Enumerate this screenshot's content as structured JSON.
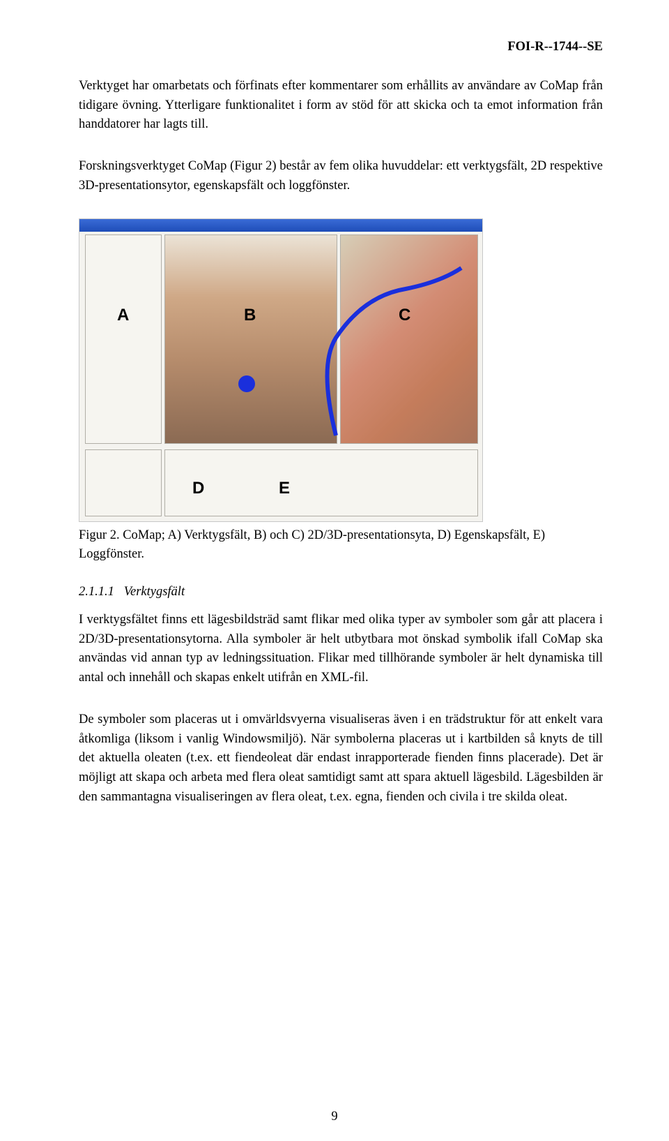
{
  "header": {
    "doc_number": "FOI-R--1744--SE"
  },
  "paragraphs": {
    "p1": "Verktyget har omarbetats och förfinats efter kommentarer som erhållits av användare av CoMap från tidigare övning. Ytterligare funktionalitet i form av stöd för att skicka och ta emot information från handdatorer har lagts till.",
    "p2": "Forskningsverktyget CoMap (Figur 2) består av fem olika huvuddelar: ett verktygsfält, 2D respektive 3D-presentationsytor, egenskapsfält och loggfönster."
  },
  "figure": {
    "labels": {
      "A": "A",
      "B": "B",
      "C": "C",
      "D": "D",
      "E": "E"
    },
    "caption": "Figur 2. CoMap; A) Verktygsfält, B) och C) 2D/3D-presentationsyta, D) Egenskapsfält, E) Loggfönster."
  },
  "subsection": {
    "number": "2.1.1.1",
    "title": "Verktygsfält"
  },
  "paragraphs2": {
    "p3": "I verktygsfältet finns ett lägesbildsträd samt flikar med olika typer av symboler som går att placera i 2D/3D-presentationsytorna. Alla symboler är helt utbytbara mot önskad symbolik ifall CoMap ska användas vid annan typ av ledningssituation. Flikar med tillhörande symboler är helt dynamiska till antal och innehåll och skapas enkelt utifrån en XML-fil.",
    "p4": "De symboler som placeras ut i omvärldsvyerna visualiseras även i en trädstruktur för att enkelt vara åtkomliga (liksom i vanlig Windowsmiljö). När symbolerna placeras ut i kartbilden så knyts de till det aktuella oleaten (t.ex. ett fiendeoleat där endast inrapporterade fienden finns placerade). Det är möjligt att skapa och arbeta med flera oleat samtidigt samt att spara aktuell lägesbild. Lägesbilden är den sammantagna visualiseringen av flera oleat, t.ex. egna, fienden och civila i tre skilda oleat."
  },
  "page_number": "9"
}
